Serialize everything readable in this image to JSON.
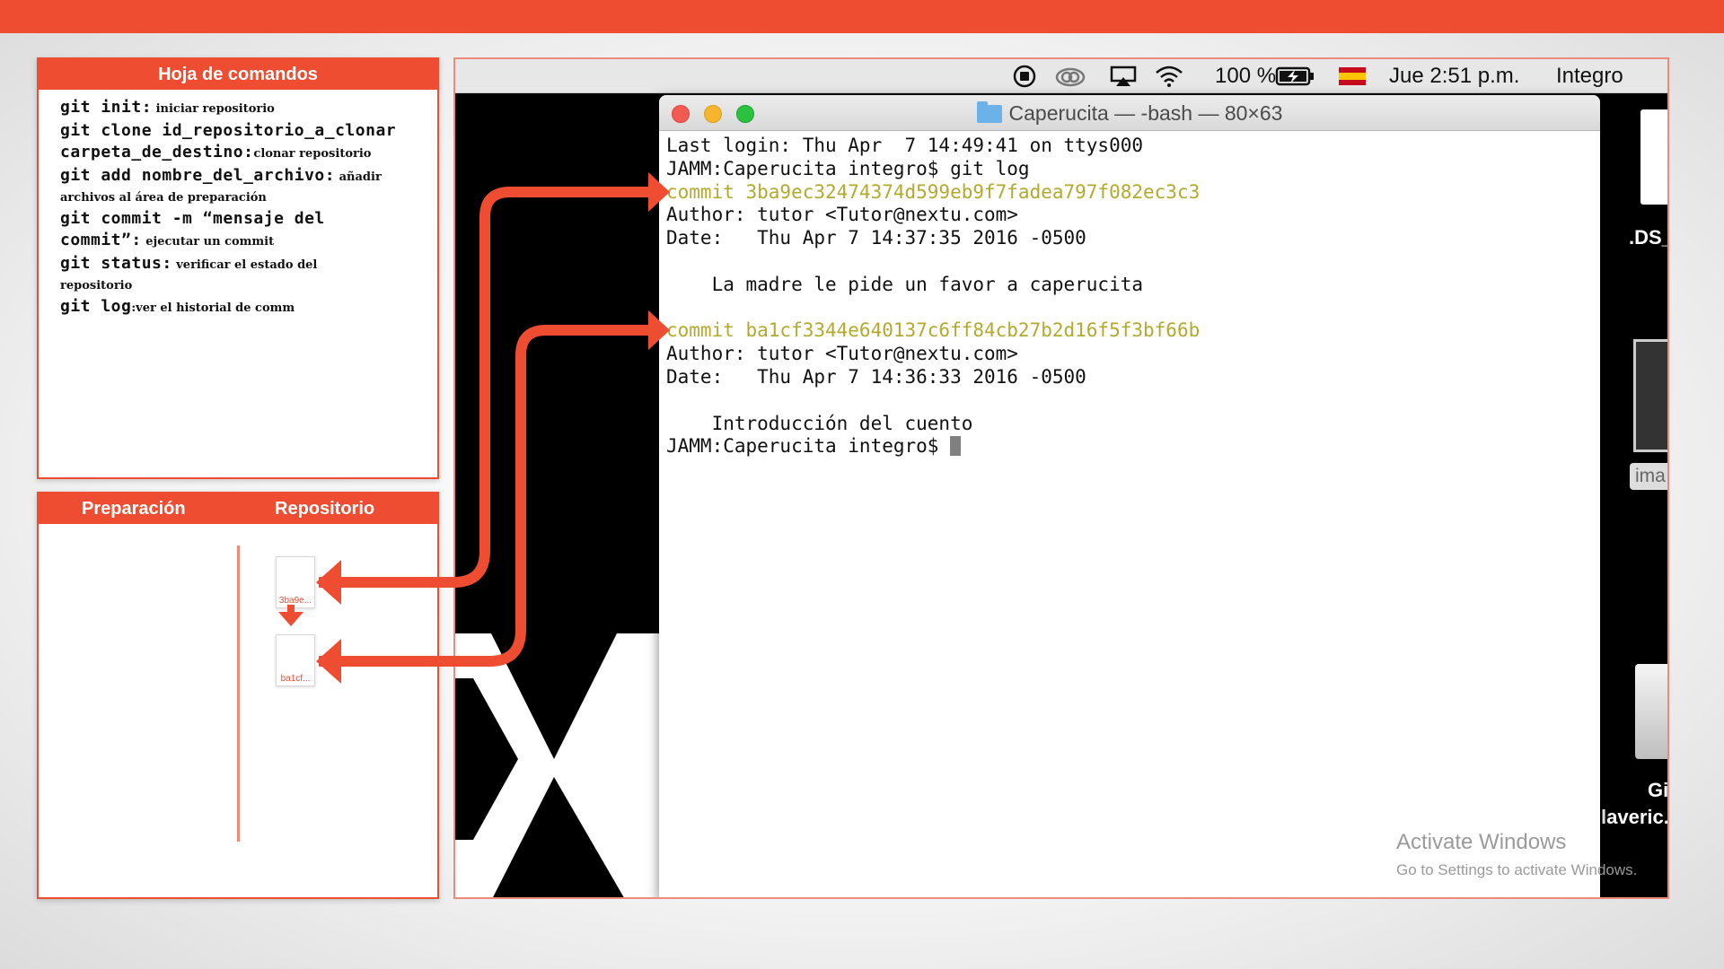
{
  "cheat_sheet": {
    "title": "Hoja de comandos",
    "lines": [
      {
        "cmd": "git init:",
        "desc": " iniciar repositorio"
      },
      {
        "cmd": "git clone id_repositorio_a_clonar",
        "desc": ""
      },
      {
        "cmd": "carpeta_de_destino:",
        "desc": "clonar repositorio"
      },
      {
        "cmd": "git add nombre_del_archivo:",
        "desc": " añadir"
      },
      {
        "cmd": "",
        "desc": "archivos al área de preparación"
      },
      {
        "cmd": "git commit -m “mensaje del",
        "desc": ""
      },
      {
        "cmd": "commit”:",
        "desc": " ejecutar un commit"
      },
      {
        "cmd": "git status:",
        "desc": " verificar el estado del"
      },
      {
        "cmd": "",
        "desc": "repositorio"
      },
      {
        "cmd": "git log",
        "desc": ":ver el historial de comm"
      }
    ]
  },
  "staging_panel": {
    "col1_label": "Preparación",
    "col2_label": "Repositorio",
    "commits": [
      "3ba9e...",
      "ba1cf..."
    ]
  },
  "menubar": {
    "battery": "100 %",
    "clock": "Jue 2:51 p.m.",
    "user": "Integro",
    "icons": [
      "record-icon",
      "creative-cloud-icon",
      "airplay-icon",
      "wifi-icon",
      "battery-icon",
      "spanish-flag-icon"
    ]
  },
  "terminal": {
    "title": "Caperucita — -bash — 80×63",
    "lines": [
      {
        "text": "Last login: Thu Apr  7 14:49:41 on ttys000",
        "type": "normal"
      },
      {
        "text": "JAMM:Caperucita integro$ git log",
        "type": "normal"
      },
      {
        "text": "commit 3ba9ec32474374d599eb9f7fadea797f082ec3c3",
        "type": "commit"
      },
      {
        "text": "Author: tutor <Tutor@nextu.com>",
        "type": "normal"
      },
      {
        "text": "Date:   Thu Apr 7 14:37:35 2016 -0500",
        "type": "normal"
      },
      {
        "text": "",
        "type": "normal"
      },
      {
        "text": "    La madre le pide un favor a caperucita",
        "type": "normal"
      },
      {
        "text": "",
        "type": "normal"
      },
      {
        "text": "commit ba1cf3344e640137c6ff84cb27b2d16f5f3bf66b",
        "type": "commit"
      },
      {
        "text": "Author: tutor <Tutor@nextu.com>",
        "type": "normal"
      },
      {
        "text": "Date:   Thu Apr 7 14:36:33 2016 -0500",
        "type": "normal"
      },
      {
        "text": "",
        "type": "normal"
      },
      {
        "text": "    Introducción del cuento",
        "type": "normal"
      }
    ],
    "prompt": "JAMM:Caperucita integro$ "
  },
  "desktop": {
    "label_ds": ".DS_",
    "label_ima": "ima",
    "label_git": "Git",
    "label_averic": "laveric."
  },
  "watermark": {
    "line1": "Activate Windows",
    "line2": "Go to Settings to activate Windows."
  },
  "colors": {
    "accent": "#ef4d32",
    "commit_hash": "#b3a92d",
    "terminal_bg": "#ffffff"
  }
}
